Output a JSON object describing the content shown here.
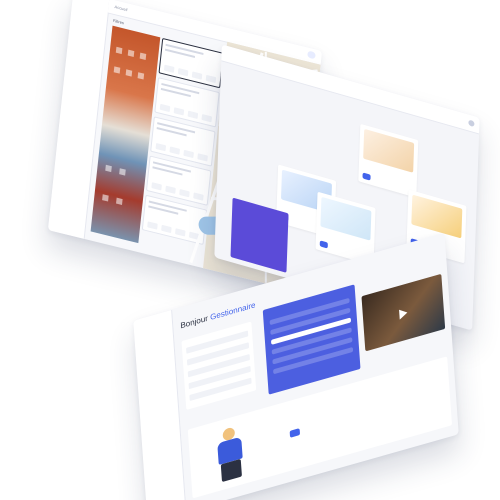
{
  "screen_a": {
    "crumb": "Accueil",
    "filter_label": "Filtres",
    "sidebar_items": [
      "",
      "",
      "",
      "",
      "",
      "",
      "",
      "",
      "",
      "",
      ""
    ],
    "status_chip": ""
  },
  "screen_b": {
    "user_name": "",
    "tiles": [
      {
        "title": "",
        "button": ""
      },
      {
        "title": "",
        "button": ""
      },
      {
        "title": "",
        "button": ""
      },
      {
        "title": "",
        "button": ""
      }
    ]
  },
  "screen_c": {
    "greeting_prefix": "Bonjour",
    "greeting_name": "Gestionnaire",
    "sidebar_items": [
      "",
      "",
      "",
      "",
      "",
      "",
      "",
      "",
      ""
    ],
    "promo_title": "",
    "promo_button": ""
  },
  "colors": {
    "accent": "#4263eb",
    "map_pin": "#7048c9",
    "board_blue": "#4c5fe0",
    "tile_purple": "#5b4bd8"
  },
  "icons": [
    "map-pin-icon",
    "play-icon",
    "avatar-icon"
  ]
}
